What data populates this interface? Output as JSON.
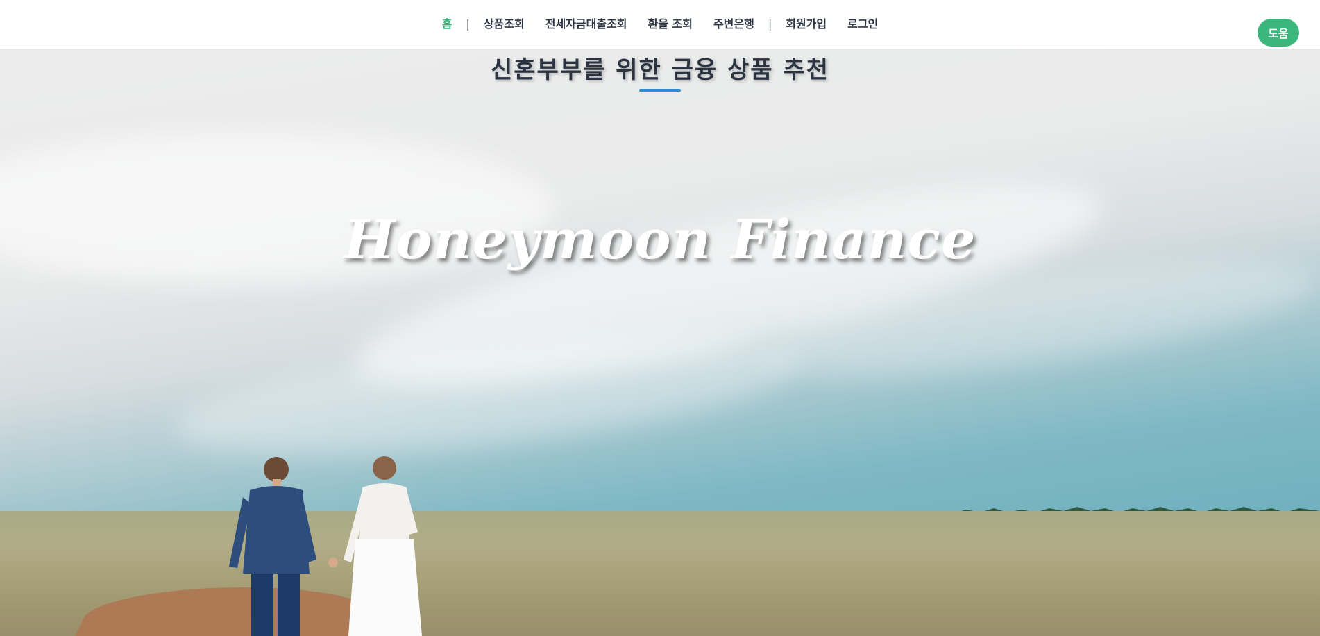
{
  "nav": {
    "items": [
      {
        "label": "홈",
        "active": true
      },
      {
        "label": "상품조회"
      },
      {
        "label": "전세자금대출조회"
      },
      {
        "label": "환율 조회"
      },
      {
        "label": "주변은행"
      },
      {
        "label": "회원가입"
      },
      {
        "label": "로그인"
      }
    ],
    "separator": "|",
    "help_label": "도움"
  },
  "hero": {
    "heading": "신혼부부를 위한 금융 상품 추천",
    "brand": "Honeymoon Finance"
  },
  "colors": {
    "accent": "#3bb77e",
    "text": "#2c3340",
    "underline": "#2b8fd6"
  }
}
